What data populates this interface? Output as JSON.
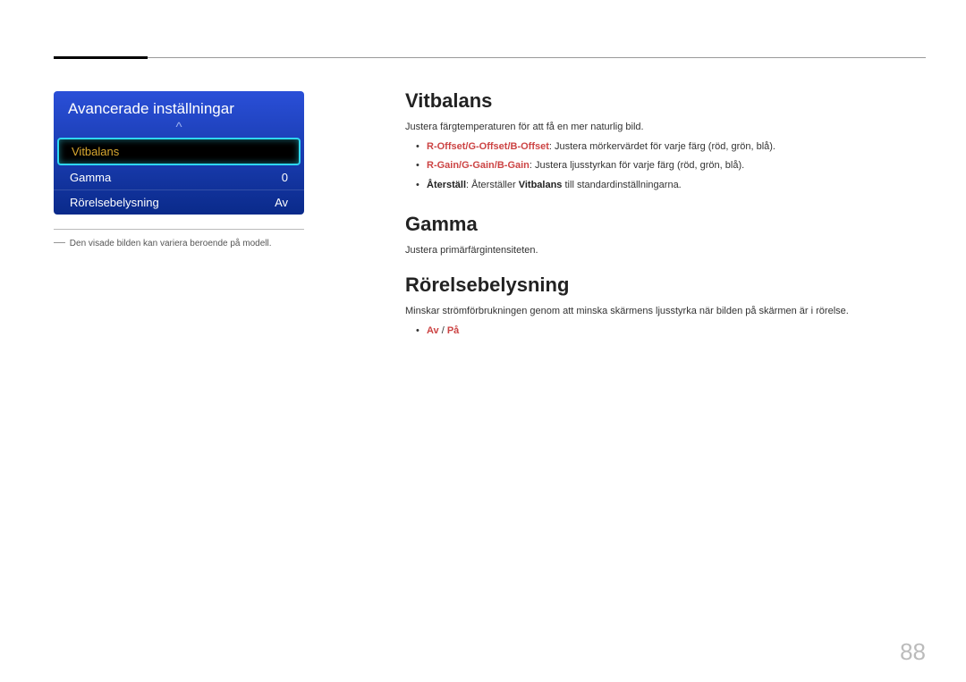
{
  "menu": {
    "title": "Avancerade inställningar",
    "caret": "^",
    "items": [
      {
        "label": "Vitbalans",
        "value": ""
      },
      {
        "label": "Gamma",
        "value": "0"
      },
      {
        "label": "Rörelsebelysning",
        "value": "Av"
      }
    ]
  },
  "note": {
    "dash": "―",
    "text": "Den visade bilden kan variera beroende på modell."
  },
  "sections": {
    "vitbalans": {
      "heading": "Vitbalans",
      "desc": "Justera färgtemperaturen för att få en mer naturlig bild.",
      "bullet1_bold": "R-Offset/G-Offset/B-Offset",
      "bullet1_rest": ": Justera mörkervärdet för varje färg (röd, grön, blå).",
      "bullet2_bold": "R-Gain/G-Gain/B-Gain",
      "bullet2_rest": ": Justera ljusstyrkan för varje färg (röd, grön, blå).",
      "bullet3_bold": "Återställ",
      "bullet3_mid": ": Återställer ",
      "bullet3_bold2": "Vitbalans",
      "bullet3_end": " till standardinställningarna."
    },
    "gamma": {
      "heading": "Gamma",
      "desc": "Justera primärfärgintensiteten."
    },
    "rorelse": {
      "heading": "Rörelsebelysning",
      "desc": "Minskar strömförbrukningen genom att minska skärmens ljusstyrka när bilden på skärmen är i rörelse.",
      "bullet1": "Av",
      "bullet1_sep": " / ",
      "bullet2": "På"
    }
  },
  "pageNumber": "88"
}
